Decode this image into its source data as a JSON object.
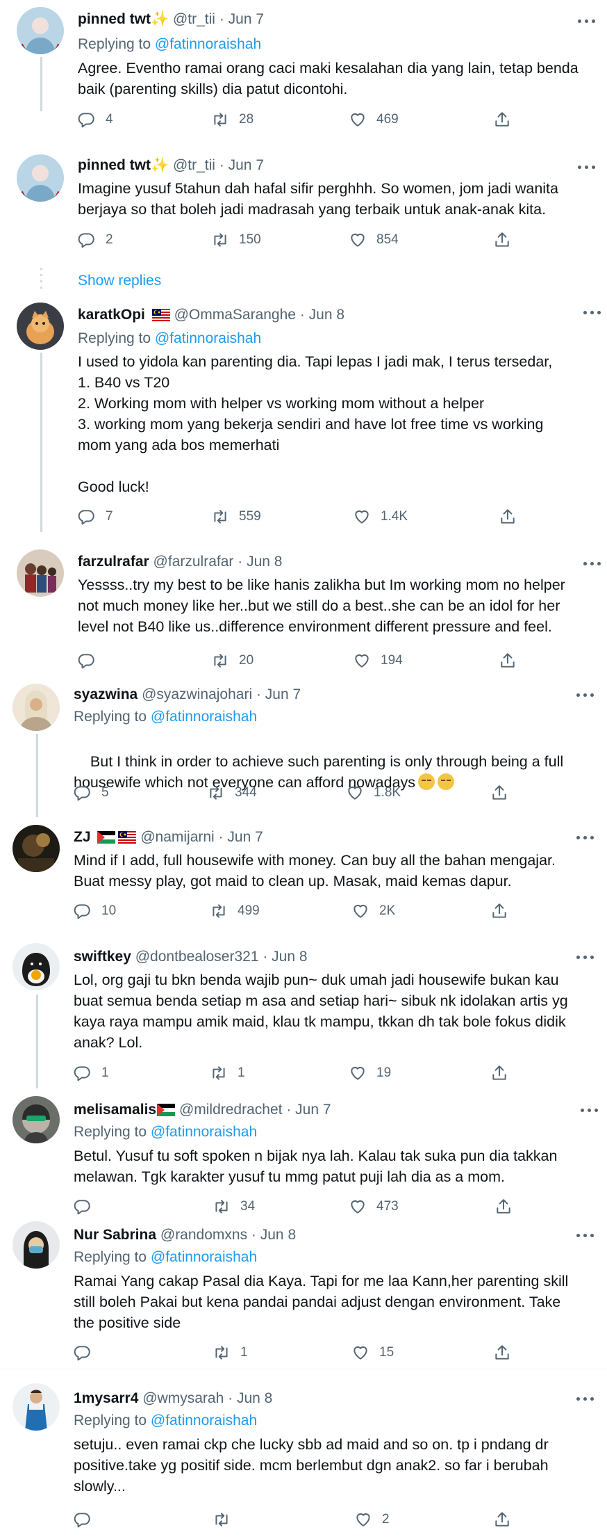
{
  "ui": {
    "show_replies": "Show replies",
    "replying_to_prefix": "Replying to "
  },
  "tweets": [
    {
      "name": "pinned twt",
      "sparkle": "✨",
      "handle": "@tr_tii",
      "date": "· Jun 7",
      "replying_to": "@fatinnoraishah",
      "body": "Agree. Eventho ramai orang caci maki kesalahan dia yang lain, tetap benda\nbaik (parenting skills) dia patut dicontohi.",
      "replies": "4",
      "retweets": "28",
      "likes": "469"
    },
    {
      "name": "pinned twt",
      "sparkle": "✨",
      "handle": "@tr_tii",
      "date": "· Jun 7",
      "body": "Imagine yusuf 5tahun dah hafal sifir perghhh. So women, jom jadi wanita\nberjaya so that boleh jadi madrasah yang terbaik untuk anak-anak kita.",
      "replies": "2",
      "retweets": "150",
      "likes": "854"
    },
    {
      "name": "karatkOpi",
      "handle": "@OmmaSaranghe",
      "date": "· Jun 8",
      "replying_to": "@fatinnoraishah",
      "body": "I used to yidola kan parenting dia. Tapi lepas I jadi mak, I terus tersedar,\n1. B40 vs T20\n2. Working mom with helper vs working mom without a helper\n3. working mom yang bekerja sendiri and have lot free time vs working\nmom yang ada bos memerhati\n\nGood luck!",
      "replies": "7",
      "retweets": "559",
      "likes": "1.4K"
    },
    {
      "name": "farzulrafar",
      "handle": "@farzulrafar",
      "date": "· Jun 8",
      "body": "Yessss..try my best to be like hanis zalikha but Im working mom no helper\nnot much money like her..but we still do a best..she can be an idol for her\nlevel not B40 like us..difference environment different pressure and feel.",
      "replies": "",
      "retweets": "20",
      "likes": "194"
    },
    {
      "name": "syazwina",
      "handle": "@syazwinajohari",
      "date": "· Jun 7",
      "replying_to": "@fatinnoraishah",
      "body": "But I think in order to achieve such parenting is only through being a full\nhousewife which not everyone can afford nowadays",
      "replies": "5",
      "retweets": "344",
      "likes": "1.8K"
    },
    {
      "name": "ZJ",
      "handle": "@namijarni",
      "date": "· Jun 7",
      "body": "Mind if I add, full housewife with money. Can buy all the bahan mengajar.\nBuat messy play, got maid to clean up. Masak, maid kemas dapur.",
      "replies": "10",
      "retweets": "499",
      "likes": "2K"
    },
    {
      "name": "swiftkey",
      "handle": "@dontbealoser321",
      "date": "· Jun 8",
      "body": "Lol, org gaji tu bkn benda wajib pun~ duk umah jadi housewife bukan kau\nbuat semua benda setiap m asa and setiap hari~ sibuk nk idolakan artis yg\nkaya raya mampu amik maid, klau tk mampu, tkkan dh tak bole fokus didik\nanak? Lol.",
      "replies": "1",
      "retweets": "1",
      "likes": "19"
    },
    {
      "name": "melisamalis",
      "handle": "@mildredrachet",
      "date": "· Jun 7",
      "replying_to": "@fatinnoraishah",
      "body": "Betul. Yusuf tu soft spoken n bijak nya lah. Kalau tak suka pun dia takkan\nmelawan. Tgk karakter yusuf tu mmg patut puji lah dia as a mom.",
      "replies": "",
      "retweets": "34",
      "likes": "473"
    },
    {
      "name": "Nur Sabrina",
      "handle": "@randomxns",
      "date": "· Jun 8",
      "replying_to": "@fatinnoraishah",
      "body": "Ramai Yang cakap Pasal dia Kaya. Tapi for me laa Kann,her parenting skill\nstill boleh Pakai but kena pandai pandai adjust dengan environment. Take\nthe positive side",
      "replies": "",
      "retweets": "1",
      "likes": "15"
    },
    {
      "name": "1mysarr4",
      "handle": "@wmysarah",
      "date": "· Jun 8",
      "replying_to": "@fatinnoraishah",
      "body": "setuju.. even ramai ckp che lucky sbb ad maid and so on. tp i pndang dr\npositive.take yg positif side. mcm berlembut dgn anak2. so far i berubah\nslowly...",
      "replies": "",
      "retweets": "",
      "likes": "2"
    }
  ]
}
